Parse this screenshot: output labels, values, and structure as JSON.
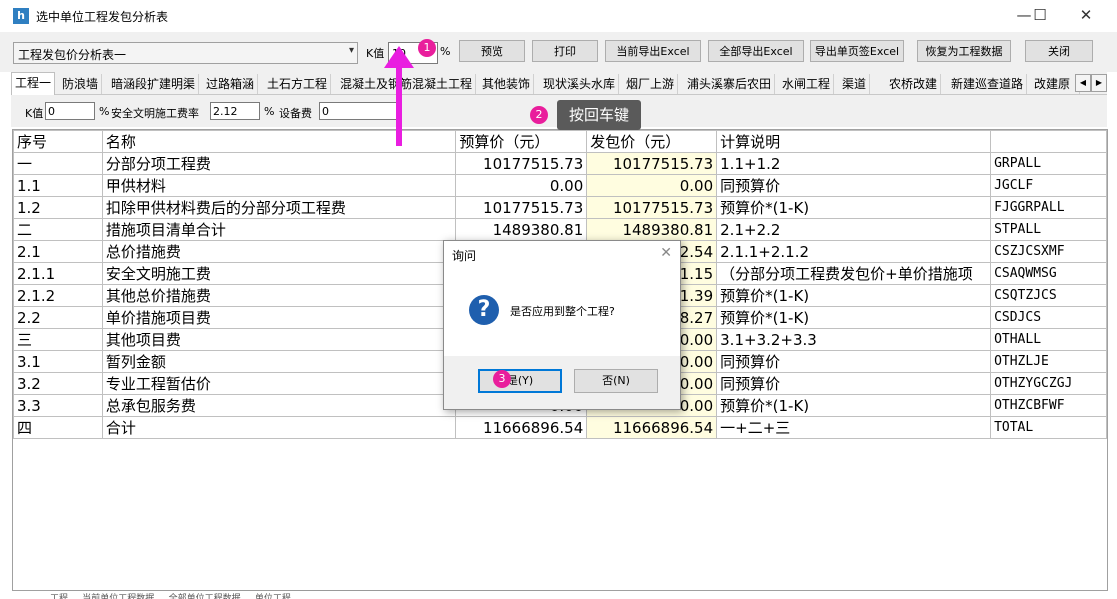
{
  "window": {
    "title": "选中单位工程发包分析表",
    "app_icon": "app-icon",
    "minimize": "—",
    "maximize": "☐",
    "close": "✕"
  },
  "toolbar": {
    "report_select": "工程发包价分析表一",
    "k_label": "K值",
    "k_value": "10",
    "percent": "%",
    "buttons": {
      "preview": "预览",
      "print": "打印",
      "export_current": "当前导出Excel",
      "export_all": "全部导出Excel",
      "export_single": "导出单页签Excel",
      "restore": "恢复为工程数据",
      "close": "关闭"
    }
  },
  "tabs": [
    "工程一",
    "防浪墙",
    "暗涵段扩建明渠",
    "过路箱涵",
    "土石方工程",
    "混凝土及钢筋混凝土工程",
    "其他装饰",
    "现状溪头水库",
    "烟厂上游",
    "浦头溪寨后农田",
    "水闸工程",
    "渠道",
    "农桥改建",
    "新建巡查道路",
    "改建原"
  ],
  "params": {
    "k_label": "K值",
    "k_value": "0",
    "pct1": "%",
    "safety_label": "安全文明施工费率",
    "safety_value": "2.12",
    "pct2": "%",
    "equip_label": "设备费",
    "equip_value": "0"
  },
  "table": {
    "headers": [
      "序号",
      "名称",
      "预算价（元）",
      "发包价（元）",
      "计算说明",
      ""
    ],
    "rows": [
      [
        "一",
        "分部分项工程费",
        "10177515.73",
        "10177515.73",
        "1.1+1.2",
        "GRPALL"
      ],
      [
        "1.1",
        "甲供材料",
        "0.00",
        "0.00",
        "同预算价",
        "JGCLF"
      ],
      [
        "1.2",
        "扣除甲供材料费后的分部分项工程费",
        "10177515.73",
        "10177515.73",
        "预算价*(1-K)",
        "FJGGRPALL"
      ],
      [
        "二",
        "措施项目清单合计",
        "1489380.81",
        "1489380.81",
        "2.1+2.2",
        "STPALL"
      ],
      [
        "2.1",
        "总价措施费",
        "",
        "2.54",
        "2.1.1+2.1.2",
        "CSZJCSXMF"
      ],
      [
        "2.1.1",
        "安全文明施工费",
        "",
        "1.15",
        "（分部分项工程费发包价+单价措施项",
        "CSAQWMSG"
      ],
      [
        "2.1.2",
        "其他总价措施费",
        "",
        "1.39",
        "预算价*(1-K)",
        "CSQTZJCS"
      ],
      [
        "2.2",
        "单价措施项目费",
        "",
        "8.27",
        "预算价*(1-K)",
        "CSDJCS"
      ],
      [
        "三",
        "其他项目费",
        "",
        "0.00",
        "3.1+3.2+3.3",
        "OTHALL"
      ],
      [
        "3.1",
        "暂列金额",
        "",
        "0.00",
        "同预算价",
        "OTHZLJE"
      ],
      [
        "3.2",
        "专业工程暂估价",
        "",
        "0.00",
        "同预算价",
        "OTHZYGCZGJ"
      ],
      [
        "3.3",
        "总承包服务费",
        "0.00",
        "0.00",
        "预算价*(1-K)",
        "OTHZCBFWF"
      ],
      [
        "四",
        "合计",
        "11666896.54",
        "11666896.54",
        "一+二+三",
        "TOTAL"
      ]
    ]
  },
  "dialog": {
    "title": "询问",
    "close": "✕",
    "icon": "question-icon",
    "icon_glyph": "?",
    "message": "是否应用到整个工程?",
    "yes": "是(Y)",
    "no": "否(N)"
  },
  "annotations": {
    "badge1": "1",
    "badge2": "2",
    "tooltip": "按回车键",
    "badge3": "3",
    "accent": "#e91ee0"
  },
  "statusbar": "工程 ... 当前单位工程数据 ... 全部单位工程数据 ... 单位工程"
}
